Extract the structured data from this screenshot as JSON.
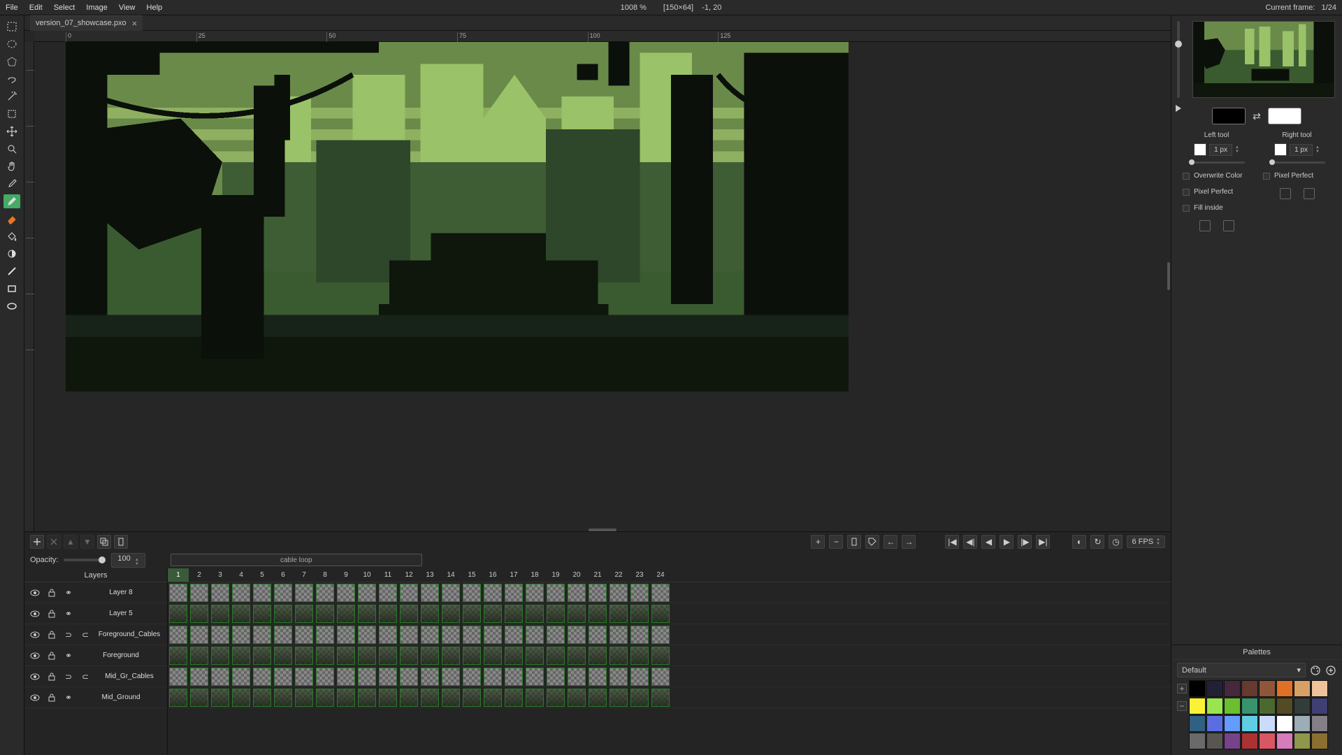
{
  "menu": {
    "items": [
      "File",
      "Edit",
      "Select",
      "Image",
      "View",
      "Help"
    ]
  },
  "topbar": {
    "zoom": "1008 %",
    "dims": "[150×64]",
    "coords": "-1, 20",
    "frame_label": "Current frame:",
    "frame_value": "1/24"
  },
  "tab": {
    "filename": "version_07_showcase.pxo"
  },
  "rulers_h": [
    0,
    25,
    50,
    75,
    100,
    125
  ],
  "tools": [
    {
      "id": "rect-select",
      "active": false
    },
    {
      "id": "ellipse-select",
      "active": false
    },
    {
      "id": "polygon-select",
      "active": false
    },
    {
      "id": "lasso",
      "active": false
    },
    {
      "id": "magic-wand",
      "active": false
    },
    {
      "id": "crop",
      "active": false
    },
    {
      "id": "move",
      "active": false
    },
    {
      "id": "zoom",
      "active": false
    },
    {
      "id": "pan",
      "active": false
    },
    {
      "id": "color-picker",
      "active": false
    },
    {
      "id": "pencil",
      "active": true
    },
    {
      "id": "eraser",
      "active": false
    },
    {
      "id": "bucket",
      "active": false
    },
    {
      "id": "shading",
      "active": false
    },
    {
      "id": "line",
      "active": false
    },
    {
      "id": "rect",
      "active": false
    },
    {
      "id": "ellipse",
      "active": false
    }
  ],
  "timeline": {
    "opacity_label": "Opacity:",
    "opacity_value": "100",
    "tag_name": "cable loop",
    "frame_count": 24,
    "active_frame": 1,
    "layers_header": "Layers",
    "layers": [
      {
        "name": "Layer 8"
      },
      {
        "name": "Layer 5"
      },
      {
        "name": "Foreground_Cables",
        "extra": true
      },
      {
        "name": "Foreground"
      },
      {
        "name": "Mid_Gr_Cables",
        "extra": true
      },
      {
        "name": "Mid_Ground"
      }
    ],
    "fps": "6 FPS"
  },
  "right": {
    "left_tool_label": "Left tool",
    "right_tool_label": "Right tool",
    "brush_size": "1 px",
    "overwrite_label": "Overwrite Color",
    "pixel_perfect_label": "Pixel Perfect",
    "fill_inside_label": "Fill inside",
    "fg_color": "#000000",
    "bg_color": "#ffffff",
    "palettes_title": "Palettes",
    "palette_name": "Default",
    "palette_colors": [
      "#000000",
      "#222034",
      "#45283c",
      "#663931",
      "#8f563b",
      "#df7126",
      "#d9a066",
      "#eec39a",
      "#fbf236",
      "#99e550",
      "#6abe30",
      "#37946e",
      "#4b692f",
      "#524b24",
      "#323c39",
      "#3f3f74",
      "#306082",
      "#5b6ee1",
      "#639bff",
      "#5fcde4",
      "#cbdbfc",
      "#ffffff",
      "#9badb7",
      "#847e87",
      "#696a6a",
      "#595652",
      "#76428a",
      "#ac3232",
      "#d95763",
      "#d77bba",
      "#8f974a",
      "#8a6f30"
    ]
  }
}
